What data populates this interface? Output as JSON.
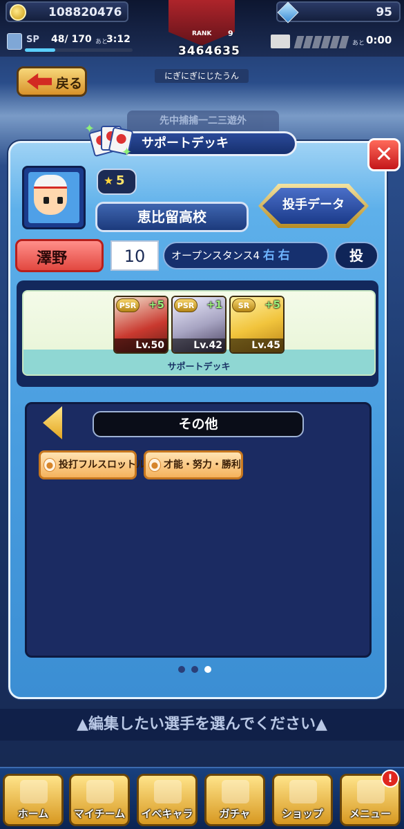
{
  "header": {
    "coins": "108820476",
    "sp_label": "SP",
    "sp_value": "48/ 170",
    "sp_ato": "あと",
    "sp_timer": "3:12",
    "sp_progress": 0.28,
    "rank_label": "RANK",
    "rank_level": "9",
    "rank_score": "3464635",
    "team_name": "にぎにぎにじたうん",
    "gems": "95",
    "stamina_ato": "あと",
    "stamina_timer": "0:00"
  },
  "nav": {
    "back_label": "戻る",
    "background_tab": "先中捕捕一二三遊外"
  },
  "dialog": {
    "title": "サポートデッキ",
    "close_label": "✕"
  },
  "player": {
    "stars": "5",
    "school": "恵比留高校",
    "data_button": "投手データ",
    "name": "澤野",
    "number": "10",
    "stance": "オープンスタンス4",
    "throw_hand": "右",
    "bat_hand": "右",
    "position_badge": "投"
  },
  "support_deck": {
    "caption": "サポートデッキ",
    "cards": [
      {
        "rarity": "PSR",
        "plus": "+5",
        "level": "Lv.50"
      },
      {
        "rarity": "PSR",
        "plus": "+1",
        "level": "Lv.42"
      },
      {
        "rarity": "SR",
        "plus": "+5",
        "level": "Lv.45"
      }
    ]
  },
  "other": {
    "title": "その他",
    "skills": [
      "投打フルスロットル",
      "才能・努力・勝利"
    ]
  },
  "pager": {
    "current": 3,
    "total": 3
  },
  "instruction": "▲編集したい選手を選んでください▲",
  "bottom_nav": {
    "items": [
      {
        "label": "ホーム"
      },
      {
        "label": "マイチーム"
      },
      {
        "label": "イベキャラ"
      },
      {
        "label": "ガチャ"
      },
      {
        "label": "ショップ"
      },
      {
        "label": "メニュー"
      }
    ],
    "badge": "!"
  },
  "colors": {
    "panel_blue": "#4a9ee0",
    "accent_gold": "#d79821",
    "close_red": "#c4161a",
    "skill_orange": "#f5b25c"
  }
}
